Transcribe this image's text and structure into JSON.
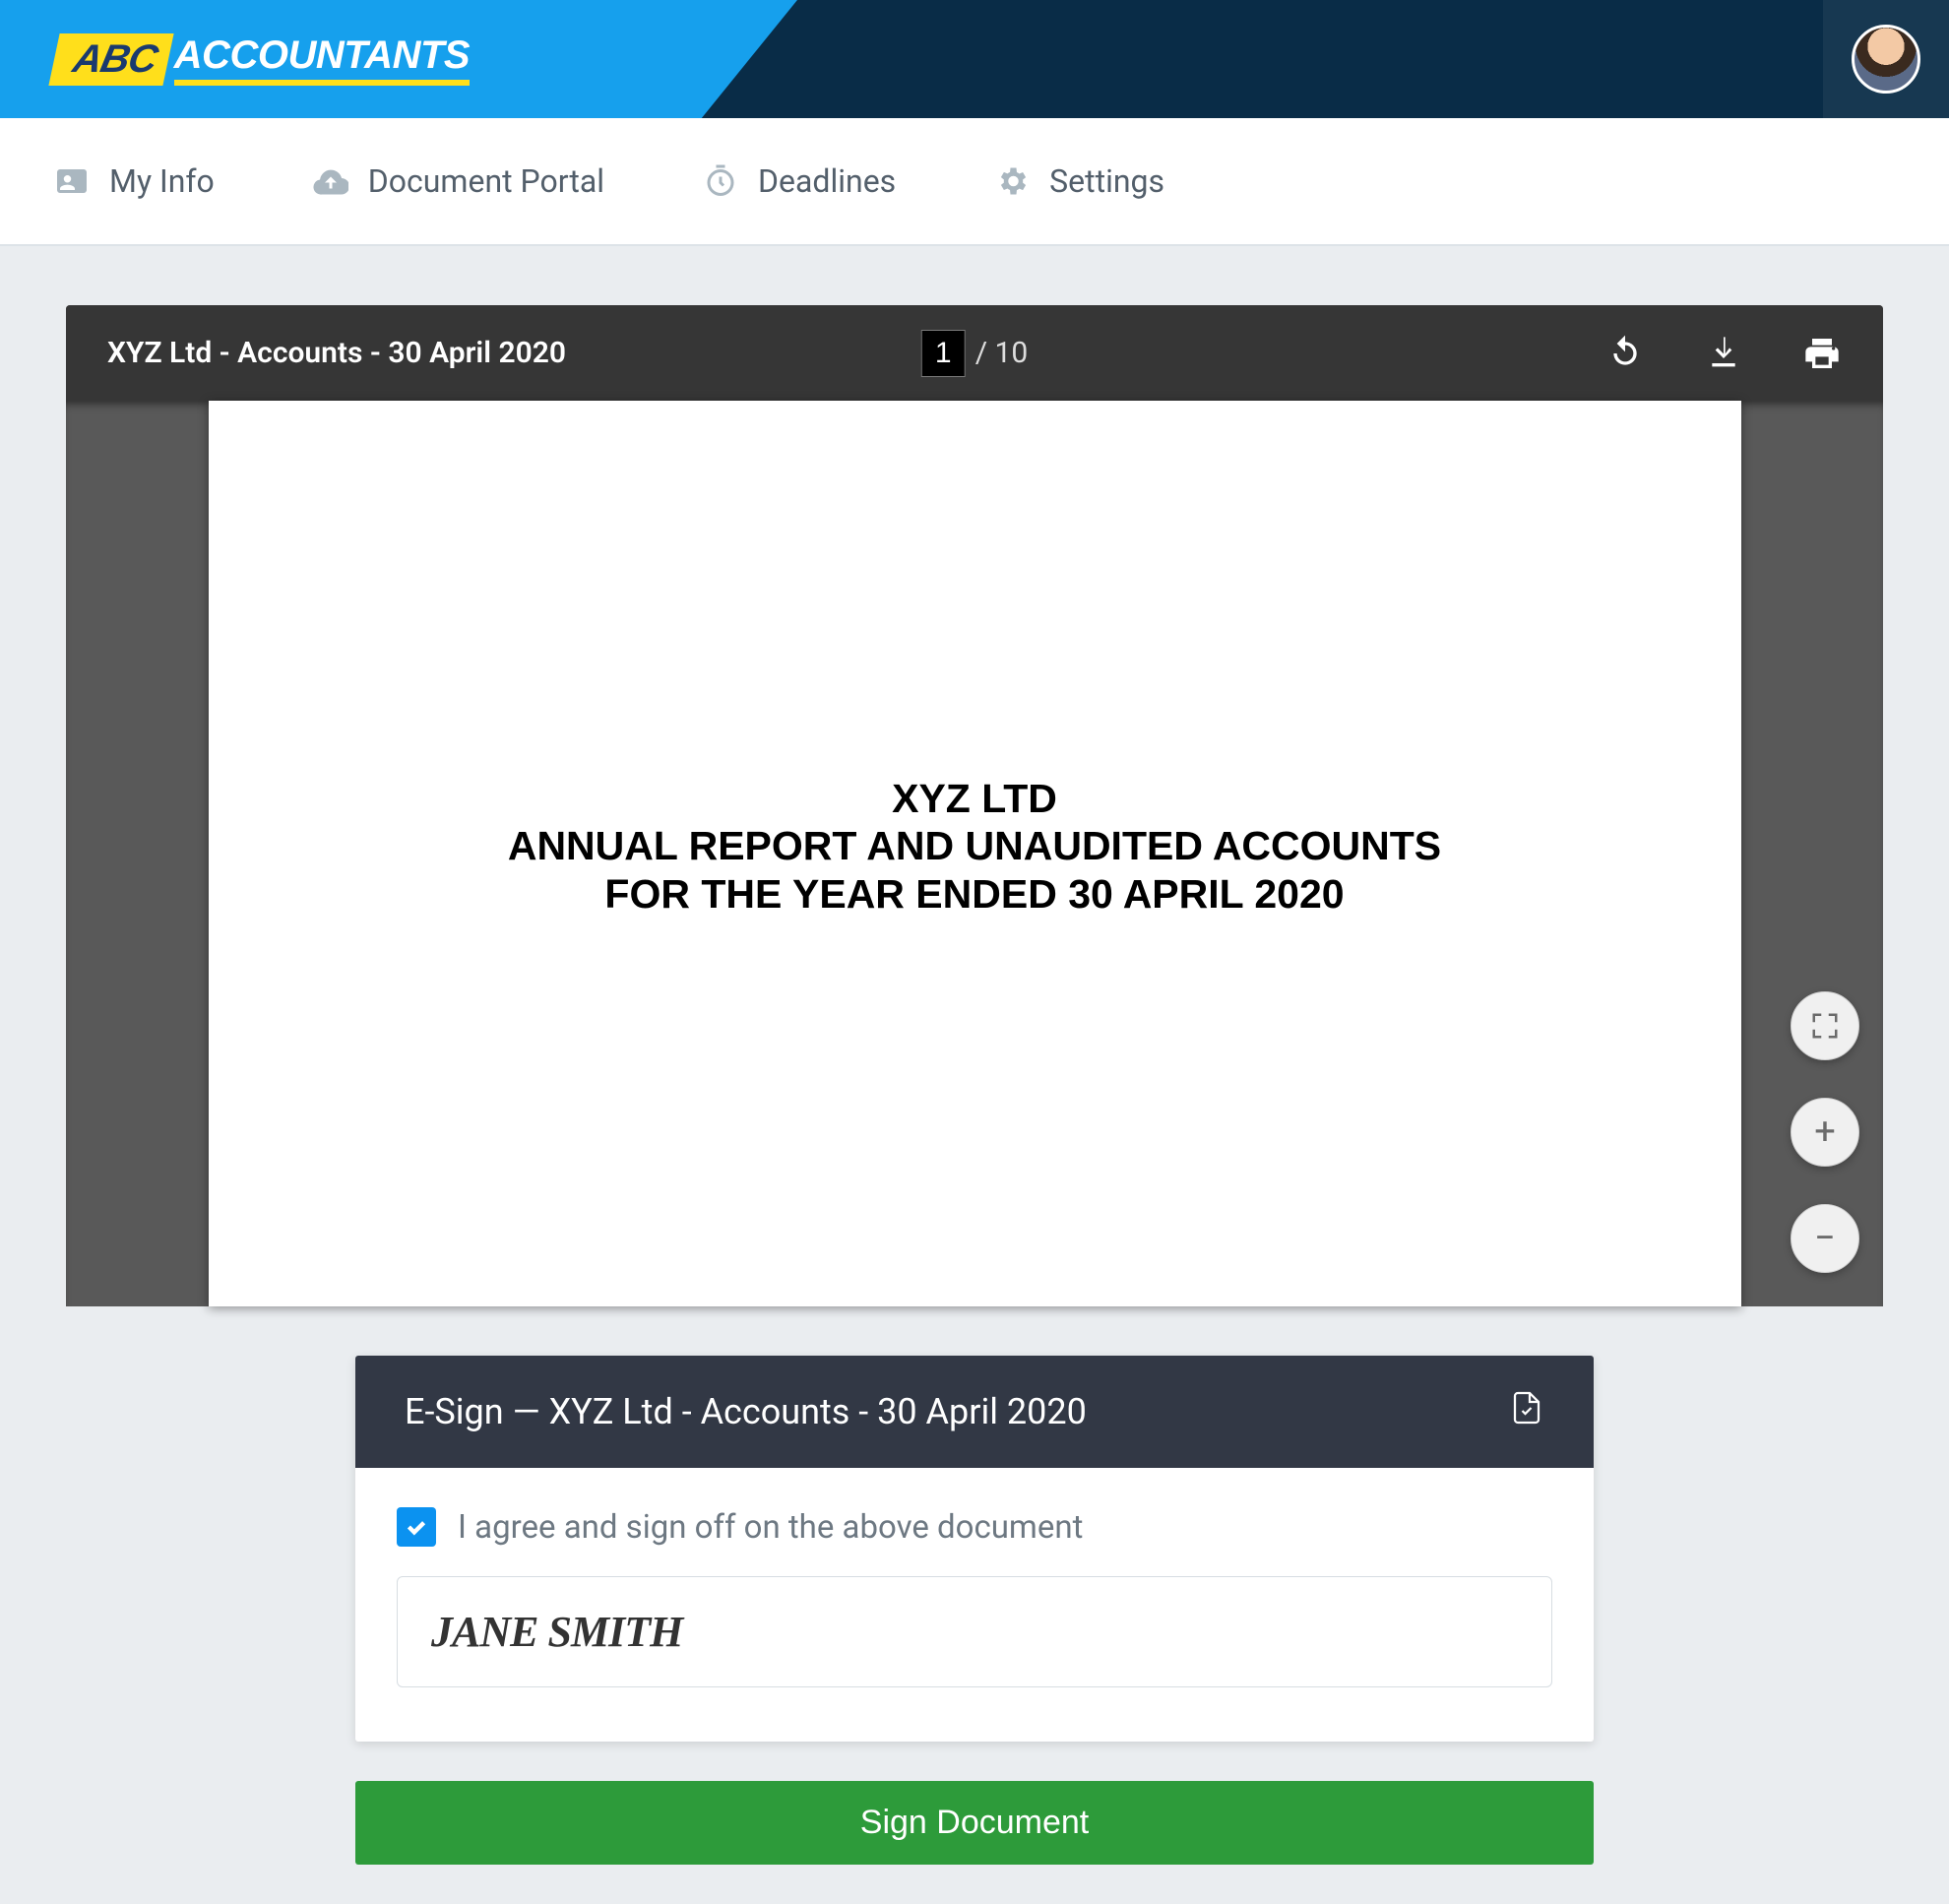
{
  "brand": {
    "abc": "ABC",
    "accountants": "ACCOUNTANTS"
  },
  "nav": {
    "my_info": "My Info",
    "doc_portal": "Document Portal",
    "deadlines": "Deadlines",
    "settings": "Settings"
  },
  "pdf": {
    "title": "XYZ Ltd - Accounts - 30 April 2020",
    "page_current": "1",
    "page_total": "10",
    "doc": {
      "line1": "XYZ LTD",
      "line2": "ANNUAL REPORT AND UNAUDITED ACCOUNTS",
      "line3": "FOR THE YEAR ENDED 30 APRIL 2020"
    }
  },
  "esign": {
    "header": "E-Sign — XYZ Ltd - Accounts - 30 April 2020",
    "agree_label": "I agree and sign off on the above document",
    "signature": "JANE SMITH"
  },
  "actions": {
    "sign_document": "Sign Document"
  }
}
